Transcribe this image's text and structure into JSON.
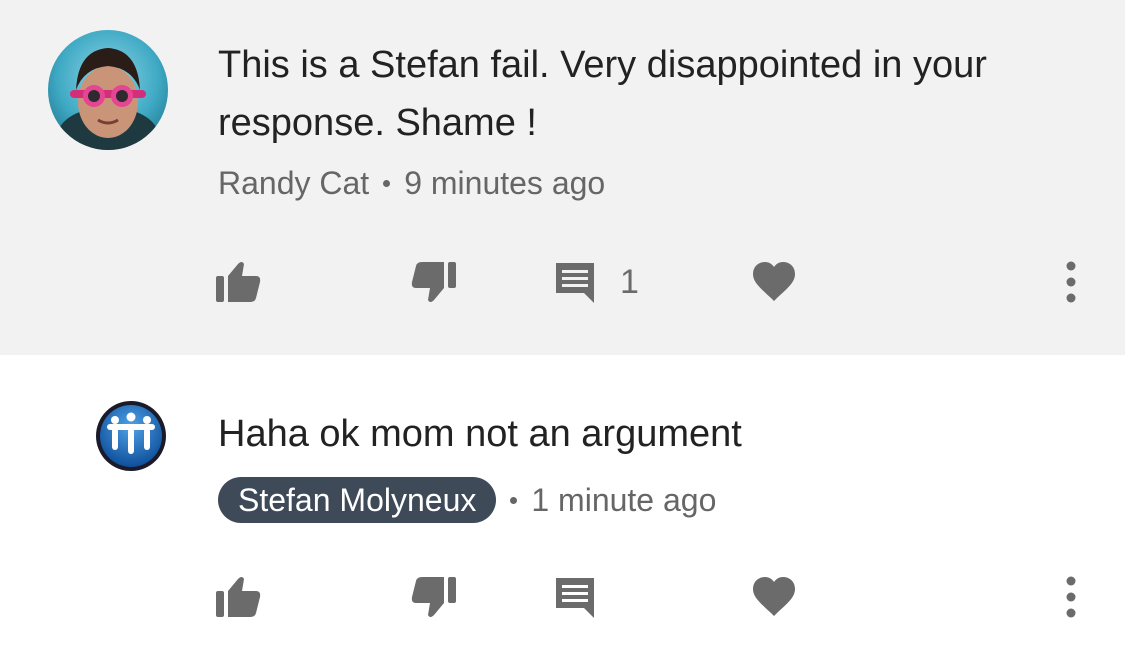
{
  "comments": [
    {
      "text": "This is a Stefan fail.  Very disappointed in your response.  Shame !",
      "author": "Randy Cat",
      "time": "9 minutes ago",
      "reply_count": "1",
      "avatar": "child-swimming-goggles-photo",
      "highlighted": true
    },
    {
      "text": "Haha ok mom not an argument",
      "author": "Stefan Molyneux",
      "time": "1 minute ago",
      "avatar": "three-figures-logo",
      "author_badge_color": "#3f4a58"
    }
  ],
  "icons": {
    "like": "thumbs-up-icon",
    "dislike": "thumbs-down-icon",
    "reply": "comment-icon",
    "favorite": "heart-icon",
    "more": "more-vertical-icon"
  },
  "colors": {
    "highlight_background": "#f2f2f2",
    "icon": "#6b6b6b",
    "meta_text": "#666666",
    "body_text": "#222222"
  }
}
